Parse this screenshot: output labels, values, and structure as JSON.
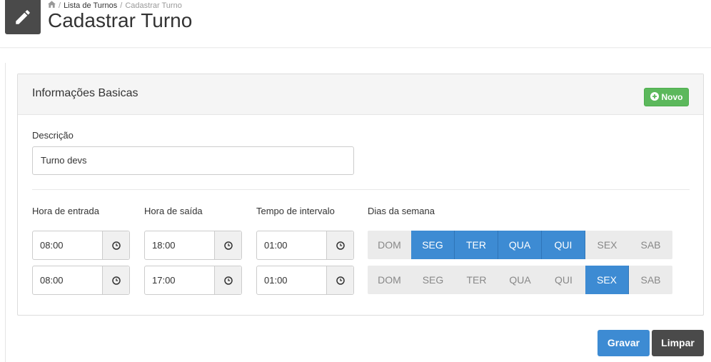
{
  "header": {
    "icon": "pencil-icon",
    "breadcrumb": {
      "home_icon": "home-icon",
      "link": "Lista de Turnos",
      "current": "Cadastrar Turno",
      "separator": "/"
    },
    "title": "Cadastrar Turno"
  },
  "panel": {
    "title": "Informações Basicas",
    "new_button": "Novo",
    "new_icon": "plus-circle-icon"
  },
  "form": {
    "descricao_label": "Descrição",
    "descricao_value": "Turno devs",
    "entrada_label": "Hora de entrada",
    "saida_label": "Hora de saída",
    "intervalo_label": "Tempo de intervalo",
    "dias_label": "Dias da semana",
    "clock_icon": "clock-icon",
    "rows": [
      {
        "entrada": "08:00",
        "saida": "18:00",
        "intervalo": "01:00",
        "days": [
          {
            "label": "DOM",
            "active": false
          },
          {
            "label": "SEG",
            "active": true
          },
          {
            "label": "TER",
            "active": true
          },
          {
            "label": "QUA",
            "active": true
          },
          {
            "label": "QUI",
            "active": true
          },
          {
            "label": "SEX",
            "active": false
          },
          {
            "label": "SAB",
            "active": false
          }
        ]
      },
      {
        "entrada": "08:00",
        "saida": "17:00",
        "intervalo": "01:00",
        "days": [
          {
            "label": "DOM",
            "active": false
          },
          {
            "label": "SEG",
            "active": false
          },
          {
            "label": "TER",
            "active": false
          },
          {
            "label": "QUA",
            "active": false
          },
          {
            "label": "QUI",
            "active": false
          },
          {
            "label": "SEX",
            "active": true
          },
          {
            "label": "SAB",
            "active": false
          }
        ]
      }
    ]
  },
  "actions": {
    "save": "Gravar",
    "clear": "Limpar"
  },
  "colors": {
    "primary": "#3d8bd3",
    "success": "#5cb85c",
    "dark": "#4a4a4a",
    "day_off_bg": "#ebebeb"
  }
}
